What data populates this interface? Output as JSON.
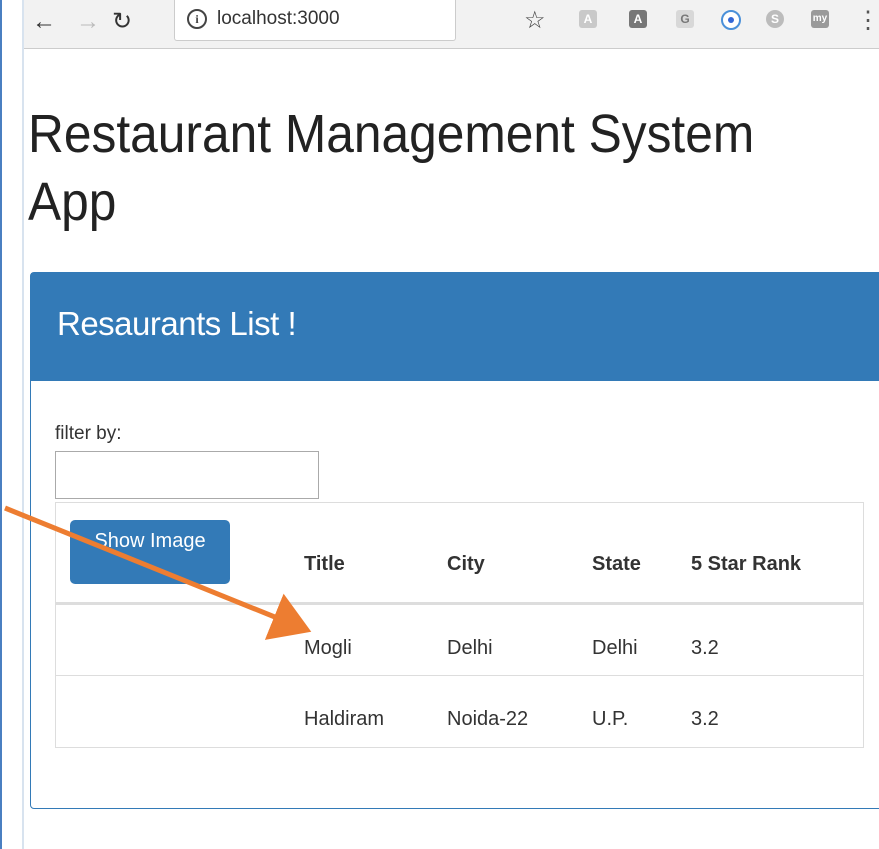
{
  "browser": {
    "url": "localhost:3000",
    "icons": [
      "back-arrow-icon",
      "forward-arrow-icon",
      "reload-icon",
      "info-icon",
      "star-icon",
      "extension-icons",
      "menu-icon"
    ],
    "extensions": {
      "a1": "A",
      "a2": "A",
      "g": "G",
      "s": "S",
      "my": "my"
    }
  },
  "page": {
    "title": "Restaurant Management System App"
  },
  "panel": {
    "heading": "Resaurants List !",
    "filter_label": "filter by:",
    "filter_value": "",
    "show_image_button": "Show Image",
    "columns": [
      "Title",
      "City",
      "State",
      "5 Star Rank"
    ],
    "rows": [
      {
        "title": "Mogli",
        "city": "Delhi",
        "state": "Delhi",
        "rank": "3.2"
      },
      {
        "title": "Haldiram",
        "city": "Noida-22",
        "state": "U.P.",
        "rank": "3.2"
      }
    ]
  },
  "colors": {
    "primary": "#337ab7",
    "annotation_arrow": "#ed7d31"
  }
}
